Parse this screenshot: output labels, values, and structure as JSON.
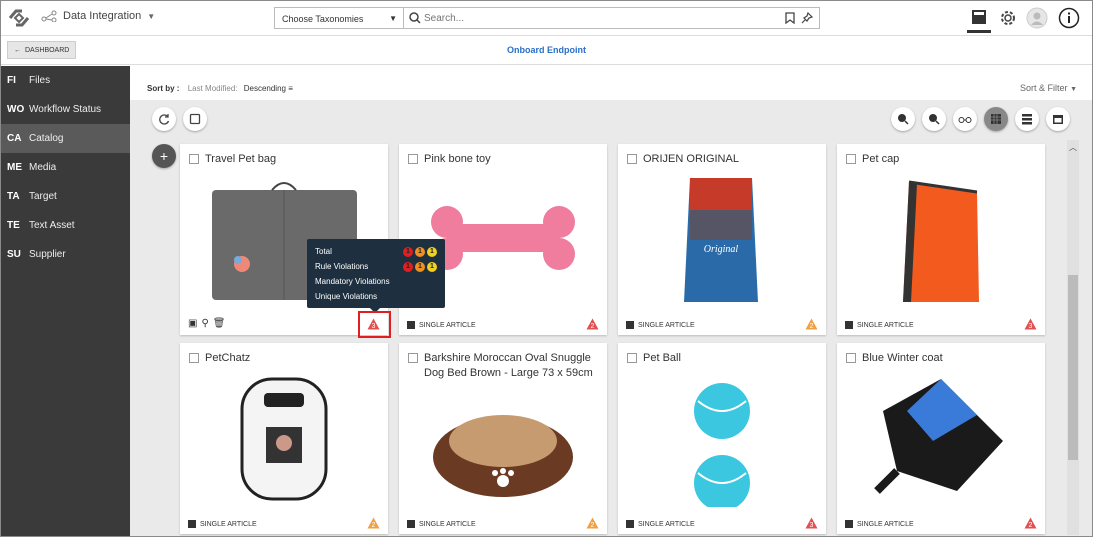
{
  "app": {
    "name": "Data Integration"
  },
  "taxonomy": {
    "label": "Choose Taxonomies"
  },
  "search": {
    "placeholder": "Search..."
  },
  "subbar": {
    "dashboard_label": "DASHBOARD",
    "page_title": "Onboard Endpoint"
  },
  "sidebar": {
    "items": [
      {
        "abbr": "FI",
        "label": "Files"
      },
      {
        "abbr": "WO",
        "label": "Workflow Status"
      },
      {
        "abbr": "CA",
        "label": "Catalog"
      },
      {
        "abbr": "ME",
        "label": "Media"
      },
      {
        "abbr": "TA",
        "label": "Target"
      },
      {
        "abbr": "TE",
        "label": "Text Asset"
      },
      {
        "abbr": "SU",
        "label": "Supplier"
      }
    ]
  },
  "sort": {
    "label": "Sort by :",
    "field": "Last Modified:",
    "order": "Descending",
    "filter": "Sort & Filter"
  },
  "cards": [
    {
      "title": "Travel Pet bag",
      "type": "",
      "warn": "3",
      "warn_color": "#e05050"
    },
    {
      "title": "Pink bone toy",
      "type": "SINGLE ARTICLE",
      "warn": "2",
      "warn_color": "#e05050"
    },
    {
      "title": "ORIJEN ORIGINAL",
      "type": "SINGLE ARTICLE",
      "warn": "2",
      "warn_color": "#f0a040"
    },
    {
      "title": "Pet cap",
      "type": "SINGLE ARTICLE",
      "warn": "3",
      "warn_color": "#e05050"
    },
    {
      "title": "PetChatz",
      "type": "SINGLE ARTICLE",
      "warn": "2",
      "warn_color": "#f0a040"
    },
    {
      "title": "Barkshire Moroccan Oval Snuggle Dog Bed Brown - Large 73 x 59cm",
      "type": "SINGLE ARTICLE",
      "warn": "2",
      "warn_color": "#f0a040"
    },
    {
      "title": "Pet Ball",
      "type": "SINGLE ARTICLE",
      "warn": "3",
      "warn_color": "#e05050"
    },
    {
      "title": "Blue Winter coat",
      "type": "SINGLE ARTICLE",
      "warn": "2",
      "warn_color": "#e05050"
    }
  ],
  "tooltip": {
    "rows": [
      {
        "label": "Total",
        "counts": [
          "1",
          "1",
          "1"
        ]
      },
      {
        "label": "Rule Violations",
        "counts": [
          "1",
          "1",
          "1"
        ]
      },
      {
        "label": "Mandatory Violations",
        "counts": []
      },
      {
        "label": "Unique Violations",
        "counts": []
      }
    ],
    "colors": [
      "#e02020",
      "#f09020",
      "#f0d020"
    ]
  }
}
